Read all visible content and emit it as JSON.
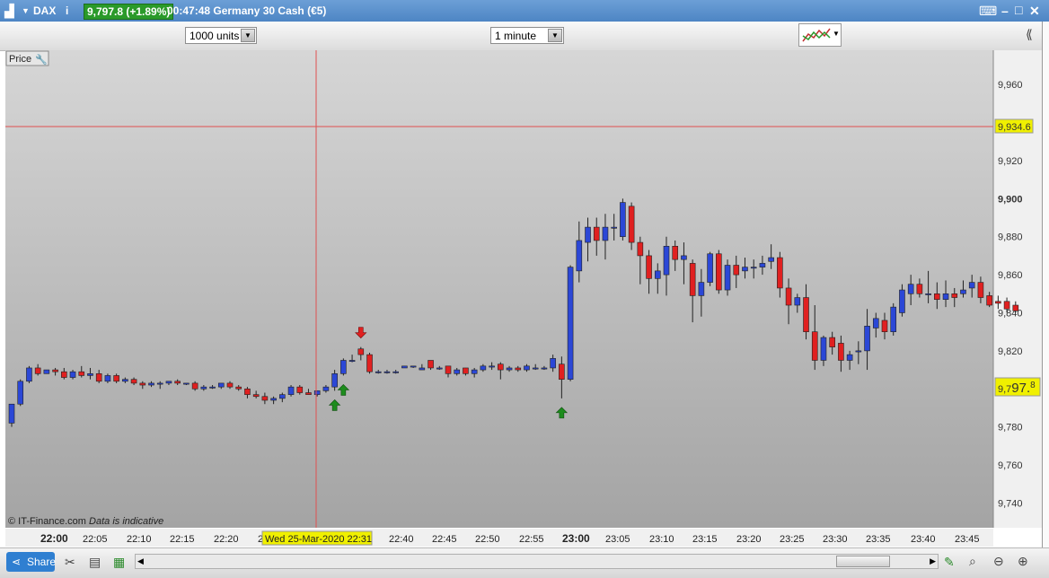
{
  "titlebar": {
    "instrument": "DAX",
    "info_icon": "info-icon",
    "price_badge": "9,797.8 (+1.89%)",
    "badge_color": "#2a9a2a",
    "description": "00:47:48 Germany 30 Cash (€5)",
    "keyboard_icon": "keyboard-icon",
    "window_buttons": [
      "minimize-icon",
      "maximize-icon",
      "close-icon"
    ]
  },
  "toolbar": {
    "units_select": "1000 units",
    "interval_select": "1 minute",
    "indicator_icon": "chart-indicators-icon"
  },
  "chart": {
    "price_label": "Price",
    "wrench_icon": "wrench-icon",
    "copyright": "© IT-Finance.com",
    "indicative": "Data is indicative",
    "crosshair_price": "9,934.6",
    "current_price_prefix": "9,7",
    "current_price_big": "97.",
    "current_price_sup": "8",
    "crosshair_time": "Wed 25-Mar-2020 22:31"
  },
  "chart_data": {
    "type": "candlestick",
    "title": "",
    "xlabel": "",
    "ylabel": "",
    "ylim": [
      9727,
      9978
    ],
    "y_ticks": [
      9960,
      9940,
      9920,
      9900,
      9880,
      9860,
      9840,
      9820,
      9800,
      9780,
      9760,
      9740
    ],
    "y_tick_labels": [
      "9,960",
      "9,940",
      "9,920",
      "9,900",
      "9,880",
      "9,860",
      "9,840",
      "9,820",
      "9,800",
      "9,780",
      "9,760",
      "9,740"
    ],
    "y_tick_bold": [
      "9,900"
    ],
    "x_tick_labels": [
      "22:00",
      "22:05",
      "22:10",
      "22:15",
      "22:20",
      "22",
      "22:40",
      "22:45",
      "22:50",
      "22:55",
      "23:00",
      "23:05",
      "23:10",
      "23:15",
      "23:20",
      "23:25",
      "23:30",
      "23:35",
      "23:40",
      "23:45"
    ],
    "x_tick_bold": [
      "22:00",
      "23:00"
    ],
    "up_color": "#2b47d6",
    "down_color": "#e02020",
    "grid": false,
    "signals": [
      {
        "type": "buy",
        "bar": 37
      },
      {
        "type": "buy",
        "bar": 38
      },
      {
        "type": "sell",
        "bar": 40
      },
      {
        "type": "buy",
        "bar": 63
      }
    ],
    "candles": [
      [
        9782,
        9792,
        9780,
        9792
      ],
      [
        9792,
        9805,
        9791,
        9804
      ],
      [
        9804,
        9812,
        9803,
        9811
      ],
      [
        9811,
        9813,
        9807,
        9808
      ],
      [
        9808,
        9810,
        9808,
        9810
      ],
      [
        9810,
        9811,
        9807,
        9809
      ],
      [
        9809,
        9811,
        9805,
        9806
      ],
      [
        9806,
        9810,
        9805,
        9809
      ],
      [
        9809,
        9812,
        9806,
        9807
      ],
      [
        9807,
        9811,
        9805,
        9808
      ],
      [
        9808,
        9810,
        9803,
        9804
      ],
      [
        9804,
        9808,
        9803,
        9807
      ],
      [
        9807,
        9808,
        9803,
        9804
      ],
      [
        9804,
        9806,
        9803,
        9805
      ],
      [
        9805,
        9806,
        9802,
        9803
      ],
      [
        9803,
        9804,
        9800,
        9802
      ],
      [
        9802,
        9804,
        9801,
        9803
      ],
      [
        9803,
        9804,
        9800,
        9803
      ],
      [
        9803,
        9804,
        9802,
        9804
      ],
      [
        9804,
        9805,
        9802,
        9803
      ],
      [
        9803,
        9803,
        9802,
        9803
      ],
      [
        9803,
        9804,
        9799,
        9800
      ],
      [
        9800,
        9802,
        9799,
        9801
      ],
      [
        9801,
        9802,
        9800,
        9801
      ],
      [
        9801,
        9803,
        9800,
        9803
      ],
      [
        9803,
        9804,
        9800,
        9801
      ],
      [
        9801,
        9802,
        9799,
        9800
      ],
      [
        9800,
        9801,
        9795,
        9797
      ],
      [
        9797,
        9799,
        9795,
        9796
      ],
      [
        9796,
        9798,
        9792,
        9794
      ],
      [
        9794,
        9796,
        9792,
        9795
      ],
      [
        9795,
        9798,
        9793,
        9797
      ],
      [
        9797,
        9802,
        9796,
        9801
      ],
      [
        9801,
        9802,
        9797,
        9798
      ],
      [
        9798,
        9800,
        9797,
        9797
      ],
      [
        9797,
        9799,
        9796,
        9799
      ],
      [
        9799,
        9802,
        9798,
        9801
      ],
      [
        9801,
        9810,
        9799,
        9808
      ],
      [
        9808,
        9816,
        9807,
        9815
      ],
      [
        9815,
        9818,
        9814,
        9815
      ],
      [
        9821,
        9822,
        9815,
        9818
      ],
      [
        9818,
        9819,
        9808,
        9809
      ],
      [
        9809,
        9810,
        9808,
        9809
      ],
      [
        9809,
        9810,
        9808,
        9809
      ],
      [
        9809,
        9810,
        9808,
        9809
      ],
      [
        9811,
        9812,
        9811,
        9812
      ],
      [
        9812,
        9812,
        9811,
        9812
      ],
      [
        9810,
        9813,
        9810,
        9811
      ],
      [
        9815,
        9815,
        9810,
        9811
      ],
      [
        9811,
        9812,
        9810,
        9811
      ],
      [
        9812,
        9812,
        9806,
        9808
      ],
      [
        9808,
        9811,
        9807,
        9810
      ],
      [
        9811,
        9811,
        9807,
        9808
      ],
      [
        9808,
        9811,
        9806,
        9810
      ],
      [
        9810,
        9813,
        9809,
        9812
      ],
      [
        9812,
        9814,
        9810,
        9812
      ],
      [
        9813,
        9814,
        9805,
        9810
      ],
      [
        9810,
        9812,
        9809,
        9811
      ],
      [
        9811,
        9812,
        9809,
        9810
      ],
      [
        9810,
        9813,
        9809,
        9812
      ],
      [
        9811,
        9813,
        9810,
        9811
      ],
      [
        9811,
        9812,
        9810,
        9811
      ],
      [
        9811,
        9818,
        9809,
        9816
      ],
      [
        9813,
        9817,
        9795,
        9805
      ],
      [
        9805,
        9865,
        9804,
        9864
      ],
      [
        9862,
        9888,
        9856,
        9878
      ],
      [
        9877,
        9890,
        9867,
        9885
      ],
      [
        9885,
        9890,
        9870,
        9878
      ],
      [
        9878,
        9892,
        9868,
        9885
      ],
      [
        9885,
        9892,
        9878,
        9885
      ],
      [
        9880,
        9900,
        9878,
        9898
      ],
      [
        9896,
        9898,
        9873,
        9877
      ],
      [
        9877,
        9880,
        9855,
        9870
      ],
      [
        9870,
        9873,
        9850,
        9858
      ],
      [
        9858,
        9866,
        9850,
        9862
      ],
      [
        9860,
        9880,
        9849,
        9875
      ],
      [
        9875,
        9878,
        9862,
        9868
      ],
      [
        9868,
        9877,
        9855,
        9870
      ],
      [
        9866,
        9868,
        9835,
        9849
      ],
      [
        9849,
        9863,
        9838,
        9856
      ],
      [
        9856,
        9872,
        9854,
        9871
      ],
      [
        9871,
        9873,
        9850,
        9852
      ],
      [
        9852,
        9868,
        9849,
        9865
      ],
      [
        9865,
        9870,
        9853,
        9860
      ],
      [
        9862,
        9869,
        9858,
        9864
      ],
      [
        9864,
        9868,
        9858,
        9864
      ],
      [
        9864,
        9870,
        9860,
        9866
      ],
      [
        9867,
        9876,
        9863,
        9869
      ],
      [
        9869,
        9872,
        9848,
        9853
      ],
      [
        9853,
        9858,
        9834,
        9844
      ],
      [
        9844,
        9850,
        9840,
        9848
      ],
      [
        9848,
        9855,
        9826,
        9830
      ],
      [
        9830,
        9844,
        9810,
        9815
      ],
      [
        9815,
        9828,
        9812,
        9827
      ],
      [
        9827,
        9830,
        9818,
        9822
      ],
      [
        9824,
        9828,
        9809,
        9815
      ],
      [
        9815,
        9820,
        9810,
        9818
      ],
      [
        9820,
        9825,
        9813,
        9820
      ],
      [
        9820,
        9842,
        9810,
        9833
      ],
      [
        9832,
        9840,
        9827,
        9837
      ],
      [
        9836,
        9840,
        9826,
        9830
      ],
      [
        9830,
        9845,
        9828,
        9843
      ],
      [
        9840,
        9855,
        9838,
        9852
      ],
      [
        9850,
        9860,
        9844,
        9855
      ],
      [
        9855,
        9858,
        9848,
        9850
      ],
      [
        9850,
        9862,
        9845,
        9850
      ],
      [
        9850,
        9856,
        9842,
        9847
      ],
      [
        9847,
        9857,
        9843,
        9850
      ],
      [
        9850,
        9853,
        9843,
        9848
      ],
      [
        9850,
        9857,
        9848,
        9852
      ],
      [
        9853,
        9860,
        9848,
        9856
      ],
      [
        9856,
        9859,
        9845,
        9848
      ],
      [
        9849,
        9851,
        9843,
        9844
      ],
      [
        9846,
        9849,
        9842,
        9845
      ],
      [
        9846,
        9848,
        9840,
        9842
      ],
      [
        9844,
        9846,
        9840,
        9841
      ]
    ]
  },
  "bottombar": {
    "share_label": "Share",
    "share_icon": "share-icon",
    "tools_icon": "tools-icon",
    "notes_icon": "notes-icon",
    "grid_icon": "grid-icon",
    "scroll_left_icon": "scroll-left-icon",
    "scroll_right_icon": "scroll-right-icon",
    "drawing_icon": "drawing-icon",
    "zoom_fit_icon": "zoom-fit-icon",
    "zoom_out_icon": "zoom-out-icon",
    "zoom_in_icon": "zoom-in-icon"
  }
}
